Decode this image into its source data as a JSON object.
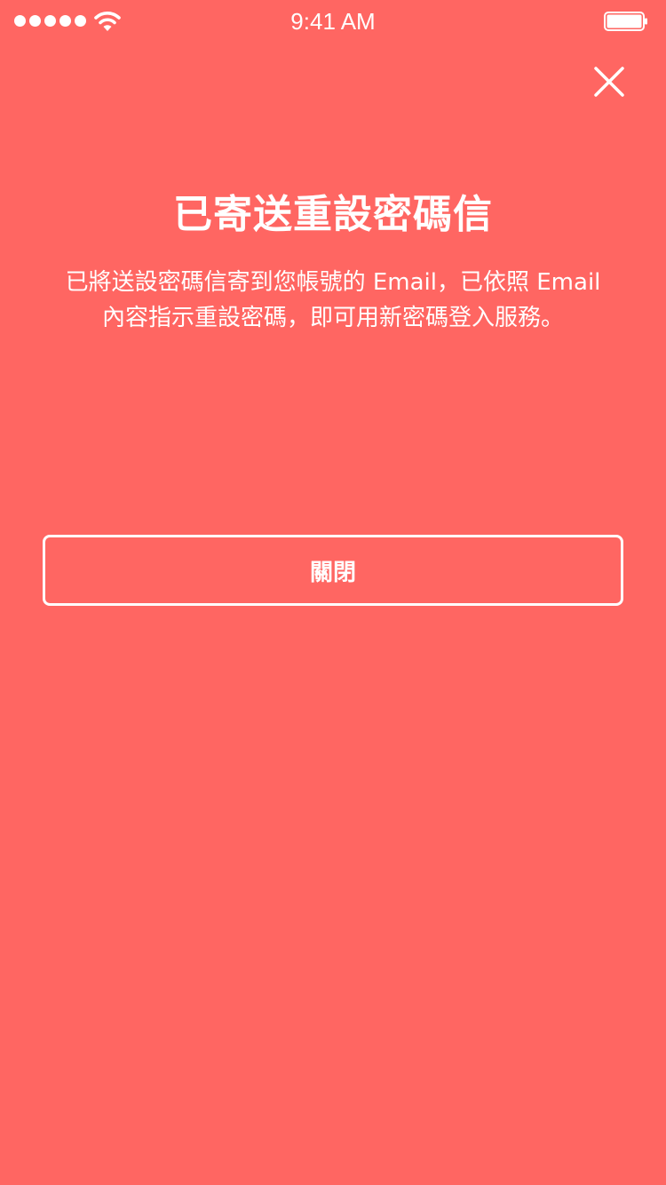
{
  "status_bar": {
    "time": "9:41 AM",
    "signal_icon": "signal-dots-icon",
    "wifi_icon": "wifi-icon",
    "battery_icon": "battery-icon",
    "battery_level": 1.0
  },
  "header": {
    "close_icon": "close-icon"
  },
  "content": {
    "title": "已寄送重設密碼信",
    "message_line1": "已將送設密碼信寄到您帳號的 Email，已依照 Email",
    "message_line2": "內容指示重設密碼，即可用新密碼登入服務。"
  },
  "actions": {
    "close_label": "關閉"
  },
  "colors": {
    "background": "#ff6662",
    "foreground": "#ffffff"
  }
}
